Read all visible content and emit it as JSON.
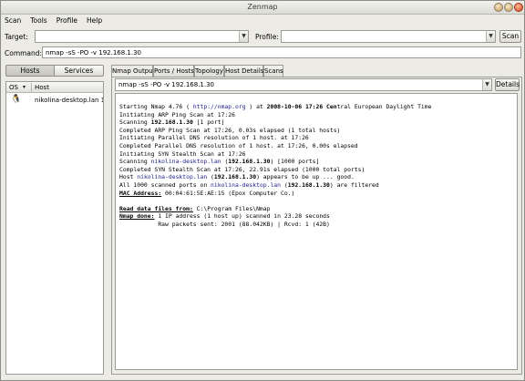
{
  "window": {
    "title": "Zenmap"
  },
  "menu": [
    "Scan",
    "Tools",
    "Profile",
    "Help"
  ],
  "target": {
    "label": "Target:",
    "value": ""
  },
  "profile": {
    "label": "Profile:",
    "value": ""
  },
  "scan_button": "Scan",
  "command": {
    "label": "Command:",
    "value": "nmap -sS -PO -v 192.168.1.30"
  },
  "left": {
    "hosts_label": "Hosts",
    "services_label": "Services",
    "col_os": "OS",
    "col_host": "Host",
    "host_row": {
      "name": "nikolina-desktop.lan 192.1",
      "icon": "linux-penguin-icon"
    }
  },
  "tabs": [
    "Nmap Output",
    "Ports / Hosts",
    "Topology",
    "Host Details",
    "Scans"
  ],
  "output_select": {
    "value": "nmap -sS -PO -v 192.168.1.30"
  },
  "details_button": "Details",
  "output": {
    "l1a": "Starting Nmap 4.76 ( ",
    "l1b": "http://nmap.org",
    "l1c": " ) at ",
    "l1d": "2008-10-06 17:26",
    "l1e": " Cen",
    "l1f": "tral European Daylight Time",
    "l2": "Initiating ARP Ping Scan at 17:26",
    "l3a": "Scanning ",
    "l3b": "192.168.1.30",
    "l3c": " [1 port]",
    "l4": "Completed ARP Ping Scan at 17:26, 0.03s elapsed (1 total hosts)",
    "l5": "Initiating Parallel DNS resolution of 1 host. at 17:26",
    "l6": "Completed Parallel DNS resolution of 1 host. at 17:26, 0.00s elapsed",
    "l7": "Initiating SYN Stealth Scan at 17:26",
    "l8a": "Scanning ",
    "l8b": "nikolina-desktop.lan",
    "l8c": " (",
    "l8d": "192.168.1.30",
    "l8e": ") [1000 ports]",
    "l9": "Completed SYN Stealth Scan at 17:26, 22.91s elapsed (1000 total ports)",
    "l10a": "Host ",
    "l10b": "nikolina-desktop.lan",
    "l10c": " (",
    "l10d": "192.168.1.30",
    "l10e": ") appears to be up ... good.",
    "l11a": "All 1000 scanned ports on ",
    "l11b": "nikolina-desktop.lan",
    "l11c": " (",
    "l11d": "192.168.1.30",
    "l11e": ") are filtered",
    "l12a": "MAC Address:",
    "l12b": " 00:04:61:5E:AE:15 (Epox Computer Co.)",
    "l13a": "Read data files from:",
    "l13b": " C:\\Program Files\\Nmap",
    "l14a": "Nmap done:",
    "l14b": " 1 IP address (1 host up) scanned in 23.28 seconds",
    "l15": "           Raw packets sent: 2001 (88.042KB) | Rcvd: 1 (42B)"
  }
}
